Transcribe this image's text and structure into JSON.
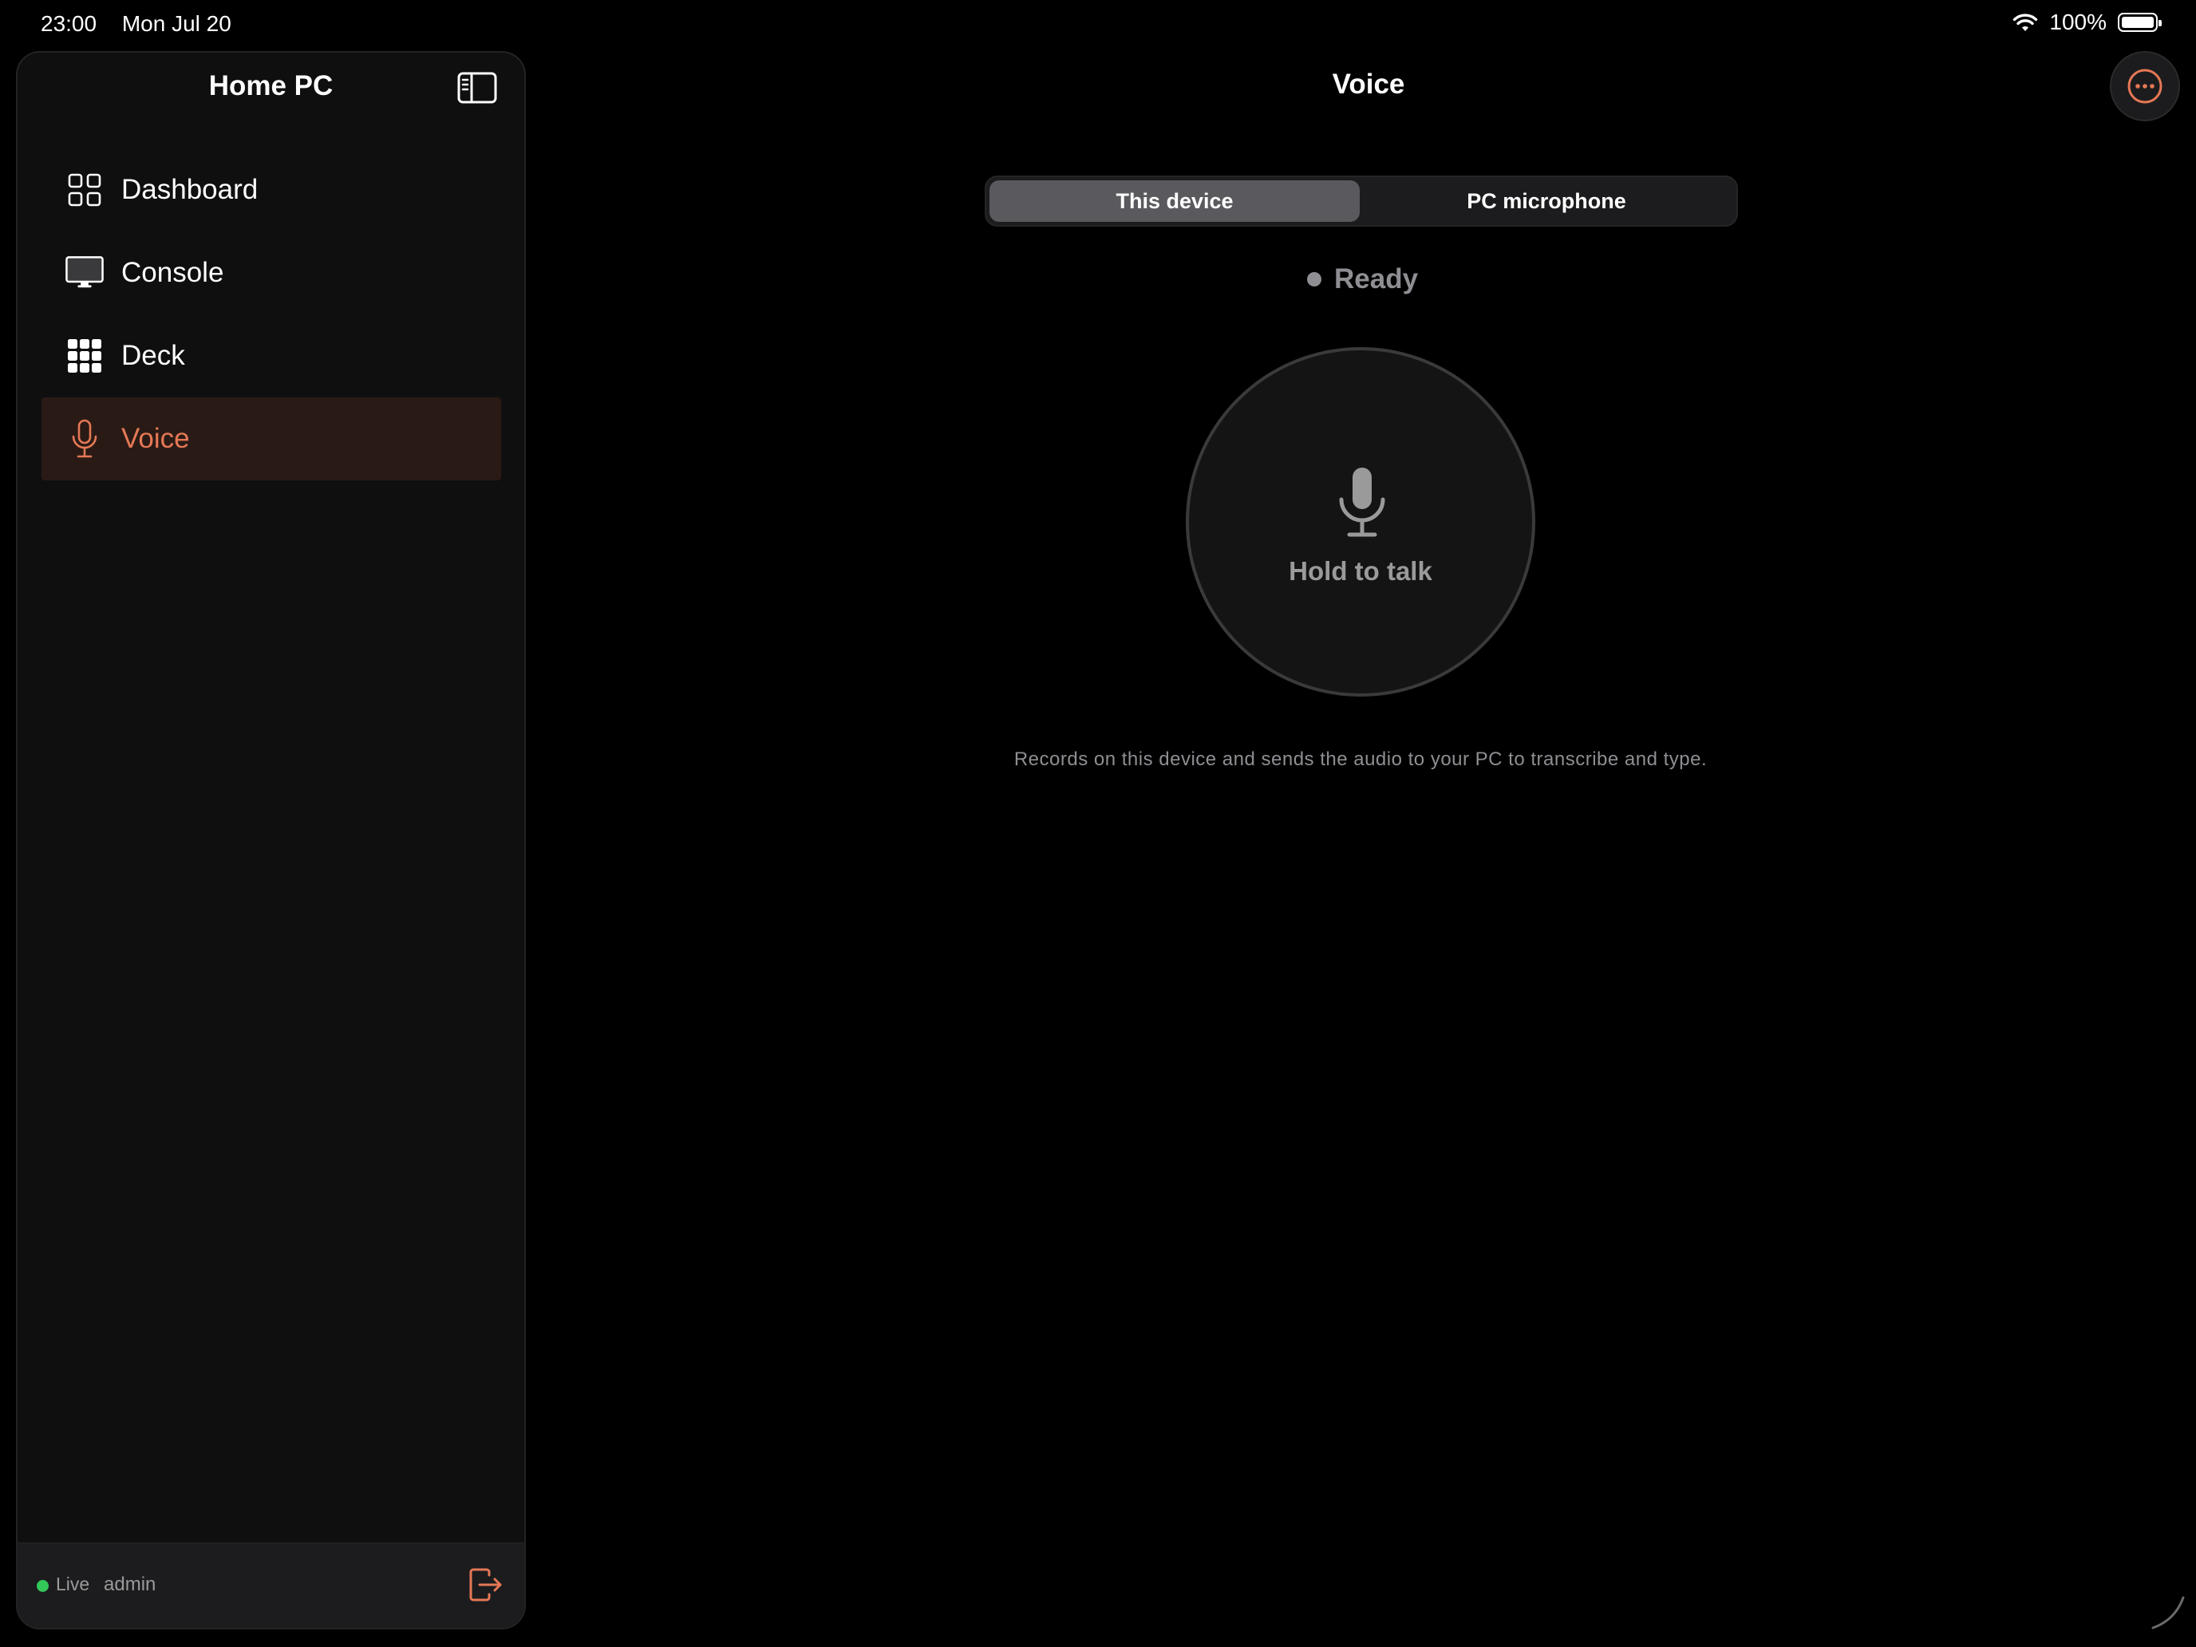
{
  "status_bar": {
    "time": "23:00",
    "date": "Mon Jul 20",
    "battery": "100%",
    "icons": [
      "wifi-icon",
      "battery-icon"
    ]
  },
  "sidebar": {
    "title": "Home PC",
    "items": [
      {
        "label": "Dashboard",
        "icon": "grid-icon",
        "active": false
      },
      {
        "label": "Console",
        "icon": "monitor-icon",
        "active": false
      },
      {
        "label": "Deck",
        "icon": "keypad-icon",
        "active": false
      },
      {
        "label": "Voice",
        "icon": "microphone-icon",
        "active": true
      }
    ],
    "footer": {
      "status": "Live",
      "user": "admin"
    }
  },
  "main": {
    "title": "Voice",
    "tabs": [
      {
        "label": "This device",
        "selected": true
      },
      {
        "label": "PC microphone",
        "selected": false
      }
    ],
    "status": "Ready",
    "talk_button_label": "Hold to talk",
    "caption": "Records on this device and sends the audio to your PC to transcribe and type."
  },
  "colors": {
    "accent": "#e57855",
    "background": "#000000",
    "sidebar_bg": "#0f0f0f",
    "active_item_bg": "#2a1a16",
    "live_green": "#34c759",
    "muted_text": "#8e8e93"
  }
}
